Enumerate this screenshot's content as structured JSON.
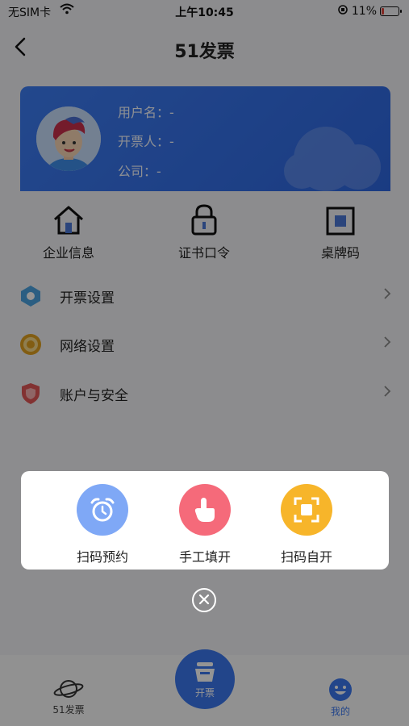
{
  "status_bar": {
    "carrier": "无SIM卡",
    "time": "上午10:45",
    "battery_percent": "11%"
  },
  "nav": {
    "title": "51发票"
  },
  "profile": {
    "username_label": "用户名：-",
    "issuer_label": "开票人：-",
    "company_label": "公司：-"
  },
  "quick_actions": [
    {
      "label": "企业信息",
      "icon": "house-icon"
    },
    {
      "label": "证书口令",
      "icon": "lock-icon"
    },
    {
      "label": "桌牌码",
      "icon": "table-card-icon"
    }
  ],
  "menu": [
    {
      "label": "开票设置",
      "icon": "hexagon-settings-icon",
      "color": "#4aa3e0"
    },
    {
      "label": "网络设置",
      "icon": "network-icon",
      "color": "#e0a020"
    },
    {
      "label": "账户与安全",
      "icon": "shield-icon",
      "color": "#e05656"
    }
  ],
  "popup": {
    "actions": [
      {
        "label": "扫码预约",
        "icon": "alarm-clock-icon",
        "color": "#7fa8f6"
      },
      {
        "label": "手工填开",
        "icon": "hand-pointer-icon",
        "color": "#f56a7a"
      },
      {
        "label": "扫码自开",
        "icon": "scan-frame-icon",
        "color": "#f7b52a"
      }
    ]
  },
  "tab_bar": {
    "home_label": "51发票",
    "center_label": "开票",
    "mine_label": "我的"
  },
  "colors": {
    "brand": "#3b78ee",
    "overlay": "rgba(0,0,0,0.42)"
  }
}
